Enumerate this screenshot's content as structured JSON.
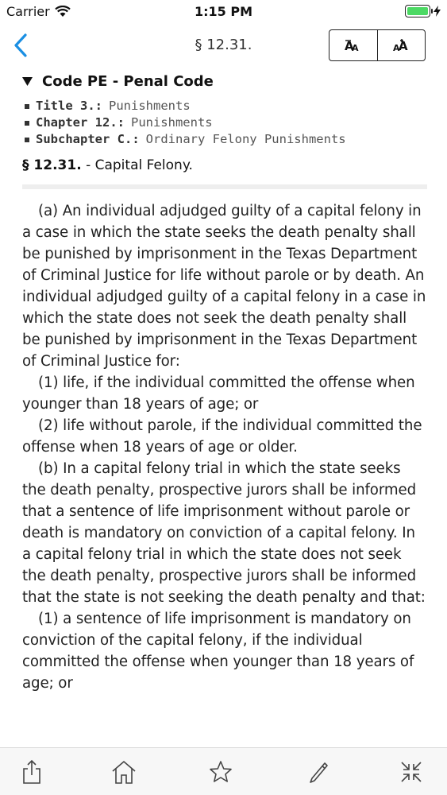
{
  "status": {
    "carrier": "Carrier",
    "time": "1:15 PM"
  },
  "nav": {
    "title": "§ 12.31.",
    "back_icon": "chevron-left-icon",
    "font_decrease_icon": "font-decrease-icon",
    "font_increase_icon": "font-increase-icon"
  },
  "code": {
    "label": "Code PE - Penal Code"
  },
  "breadcrumbs": [
    {
      "key": "Title 3.:",
      "value": "Punishments"
    },
    {
      "key": "Chapter 12.:",
      "value": "Punishments"
    },
    {
      "key": "Subchapter C.:",
      "value": "Ordinary Felony Punishments"
    }
  ],
  "section": {
    "number": "§ 12.31.",
    "title": "- Capital Felony."
  },
  "paragraphs": [
    "(a) An individual adjudged guilty of a capital felony in a case in which the state seeks the death penalty shall be punished by imprisonment in the Texas Department of Criminal Justice for life without parole or by death. An individual adjudged guilty of a capital felony in a case in which the state does not seek the death penalty shall be punished by imprisonment in the Texas Department of Criminal Justice for:",
    "(1) life, if the individual committed the offense when younger than 18 years of age; or",
    "(2) life without parole, if the individual committed the offense when 18 years of age or older.",
    "(b) In a capital felony trial in which the state seeks the death penalty, prospective jurors shall be informed that a sentence of life imprisonment without parole or death is mandatory on conviction of a capital felony. In a capital felony trial in which the state does not seek the death penalty, prospective jurors shall be informed that the state is not seeking the death penalty and that:",
    "(1) a sentence of life imprisonment is mandatory on conviction of the capital felony, if the individual committed the offense when younger than 18 years of age; or"
  ],
  "toolbar": {
    "icons": [
      "share-icon",
      "home-icon",
      "star-icon",
      "pencil-icon",
      "collapse-icon"
    ]
  },
  "colors": {
    "accent": "#1a8fe3",
    "battery": "#4cd964"
  }
}
